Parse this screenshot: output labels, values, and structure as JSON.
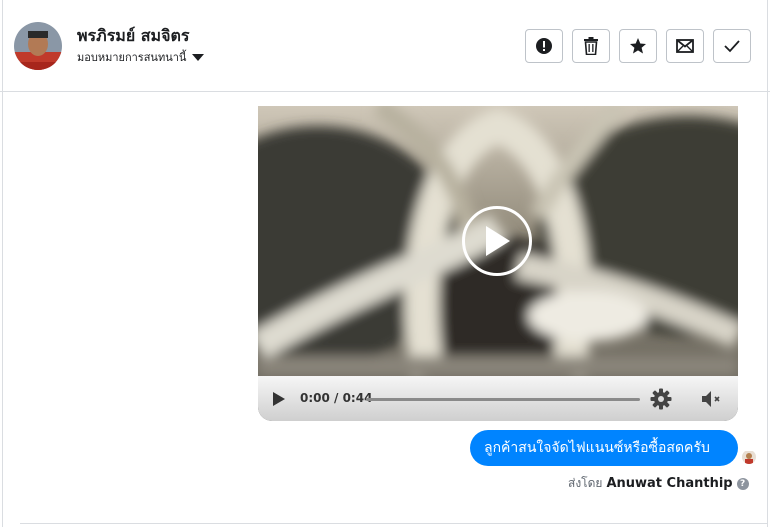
{
  "header": {
    "contact_name": "พรภิรมย์ สมจิตร",
    "assign_label": "มอบหมายการสนทนานี้",
    "actions": [
      {
        "name": "report-spam",
        "icon": "exclamation-circle-icon"
      },
      {
        "name": "delete",
        "icon": "trash-icon"
      },
      {
        "name": "star",
        "icon": "star-icon"
      },
      {
        "name": "mark-unread",
        "icon": "envelope-icon"
      },
      {
        "name": "mark-done",
        "icon": "checkmark-icon"
      }
    ]
  },
  "video": {
    "current_time": "0:00",
    "duration": "0:44",
    "time_display": "0:00 / 0:44",
    "progress": 0
  },
  "message": {
    "text": "ลูกค้าสนใจจัดไฟแนนซ์หรือซื้อสดครับ",
    "sent_by_label": "ส่งโดย",
    "agent_name": "Anuwat Chanthip",
    "bubble_color": "#0084ff"
  }
}
